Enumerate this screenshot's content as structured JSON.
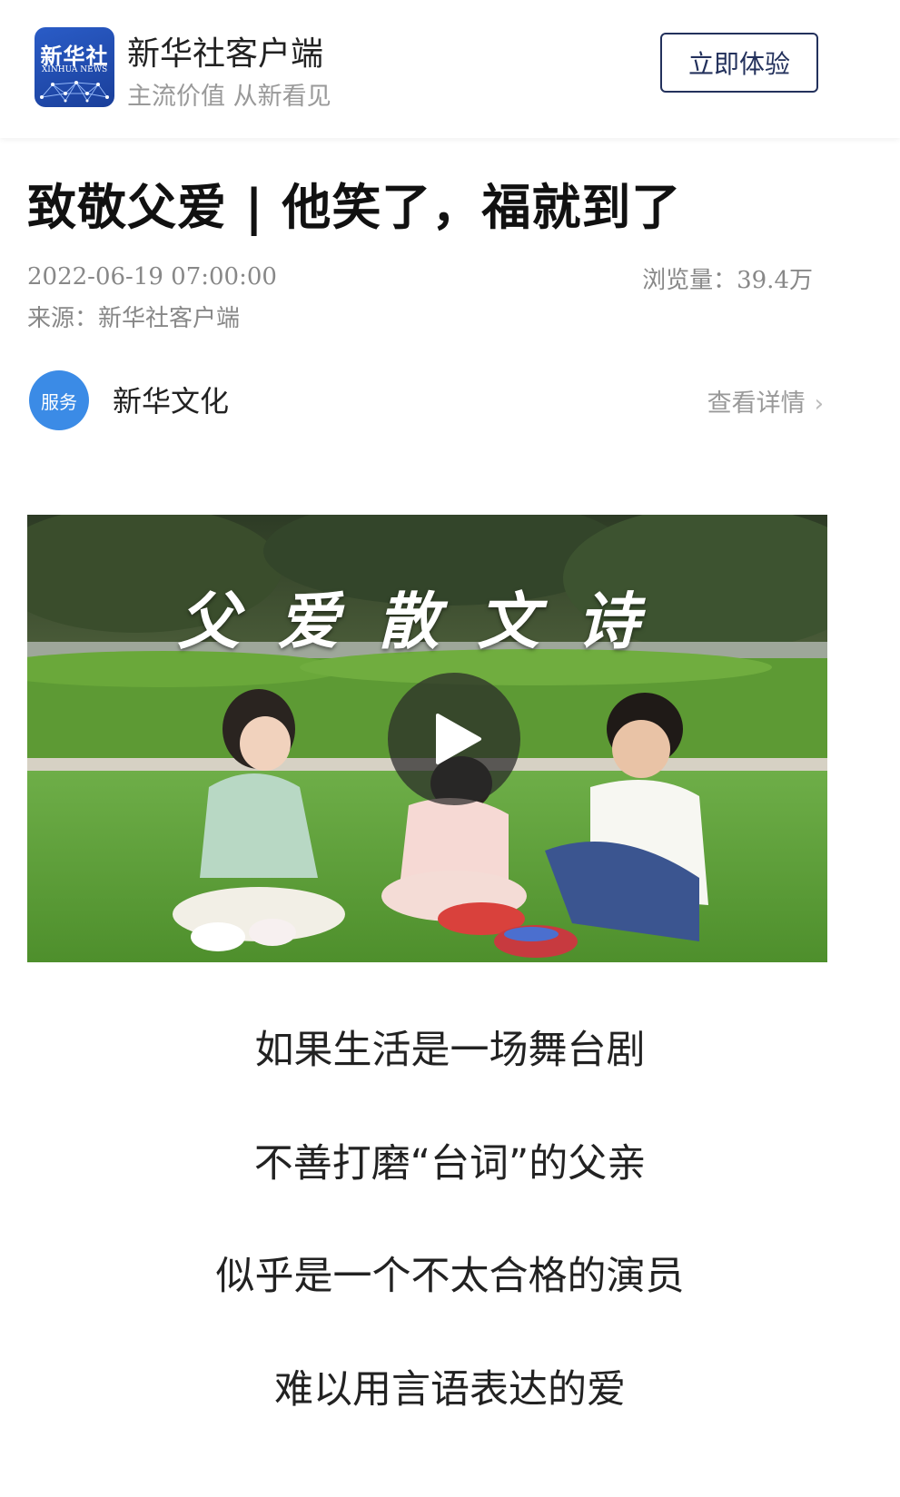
{
  "banner": {
    "logo_cn": "新华社",
    "logo_en": "XINHUA NEWS",
    "app_name": "新华社客户端",
    "slogan": "主流价值 从新看见",
    "cta_label": "立即体验"
  },
  "article": {
    "title": "致敬父爱 | 他笑了，福就到了",
    "datetime": "2022-06-19 07:00:00",
    "views_label": "浏览量：",
    "views_value": "39.4万",
    "source": "来源：新华社客户端"
  },
  "service": {
    "badge": "服务",
    "name": "新华文化",
    "details_label": "查看详情"
  },
  "video": {
    "caption": "父爱散文诗",
    "play_icon": "play-icon"
  },
  "poem": [
    "如果生活是一场舞台剧",
    "不善打磨“台词”的父亲",
    "似乎是一个不太合格的演员",
    "难以用言语表达的爱"
  ],
  "colors": {
    "cta_border": "#23315c",
    "service_badge": "#3b8be6",
    "logo_blue": "#1a3f9a"
  }
}
